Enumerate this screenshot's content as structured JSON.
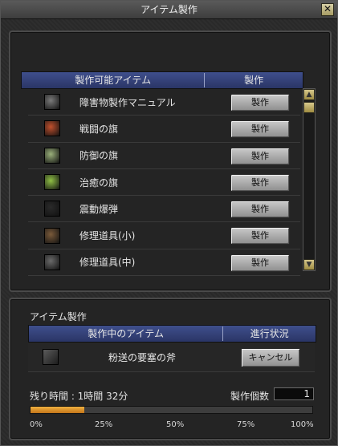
{
  "window": {
    "title": "アイテム製作",
    "close_icon": "close-icon"
  },
  "craftable": {
    "header_name": "製作可能アイテム",
    "header_action": "製作",
    "items": [
      {
        "name": "障害物製作マニュアル",
        "icon": "manual-icon",
        "icon_color": "#7a7a7a",
        "button": "製作"
      },
      {
        "name": "戦闘の旗",
        "icon": "battle-flag-icon",
        "icon_color": "#c0502d",
        "button": "製作"
      },
      {
        "name": "防御の旗",
        "icon": "defense-flag-icon",
        "icon_color": "#9ab07a",
        "button": "製作"
      },
      {
        "name": "治癒の旗",
        "icon": "healing-flag-icon",
        "icon_color": "#8fbf45",
        "button": "製作"
      },
      {
        "name": "震動爆弾",
        "icon": "bomb-icon",
        "icon_color": "#2a2a2a",
        "button": "製作"
      },
      {
        "name": "修理道具(小)",
        "icon": "pickaxe-icon",
        "icon_color": "#7a5a3a",
        "button": "製作"
      },
      {
        "name": "修理道具(中)",
        "icon": "pickaxe-icon",
        "icon_color": "#6a6a6a",
        "button": "製作"
      }
    ]
  },
  "production": {
    "section_title": "アイテム製作",
    "header_name": "製作中のアイテム",
    "header_state": "進行状況",
    "item": {
      "name": "粉送の要塞の斧",
      "icon": "axe-icon",
      "button": "キャンセル"
    },
    "remaining_time": "残り時間 : 1時間 32分",
    "count_label": "製作個数",
    "count_value": "1",
    "progress_fraction": 0.19,
    "progress_color": "#e3a040",
    "ticks": [
      "0%",
      "25%",
      "50%",
      "75%",
      "100%"
    ]
  }
}
